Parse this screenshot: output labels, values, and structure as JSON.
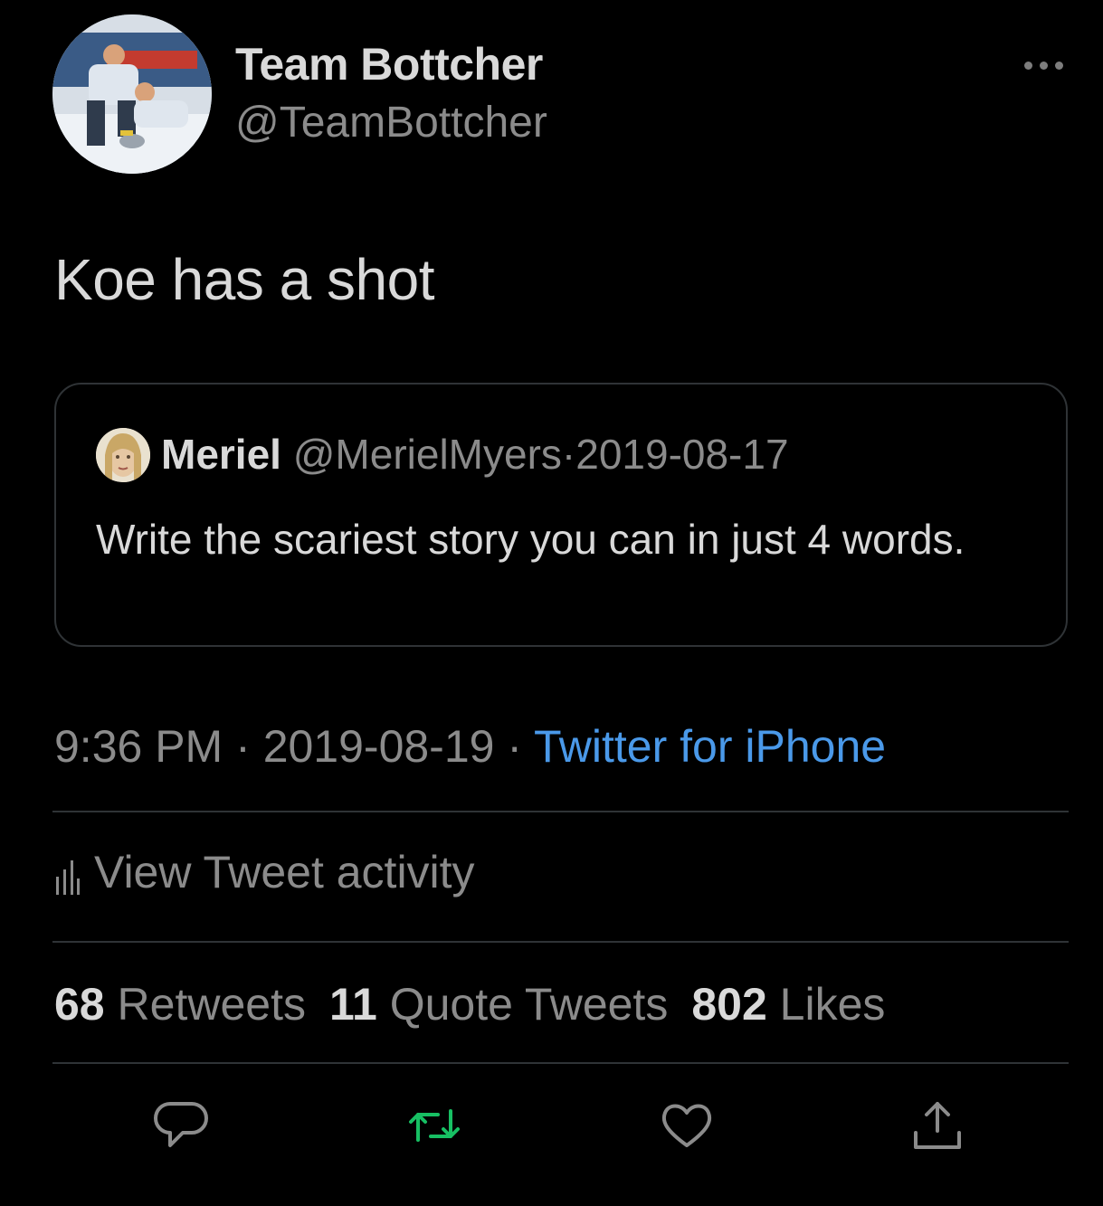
{
  "author": {
    "name": "Team Bottcher",
    "handle": "@TeamBottcher"
  },
  "tweet": {
    "text": "Koe has a shot"
  },
  "quoted": {
    "name": "Meriel",
    "handle": "@MerielMyers",
    "separator": "·",
    "date": "2019-08-17",
    "text": "Write the scariest story you can in just 4 words."
  },
  "meta": {
    "time": "9:36 PM",
    "separator": "·",
    "date": "2019-08-19",
    "source": "Twitter for iPhone"
  },
  "activity": {
    "label": "View Tweet activity"
  },
  "stats": {
    "retweets_count": "68",
    "retweets_label": "Retweets",
    "quotes_count": "11",
    "quotes_label": "Quote Tweets",
    "likes_count": "802",
    "likes_label": "Likes"
  },
  "colors": {
    "background": "#000000",
    "text": "#d9d9d9",
    "muted": "#8b8b8b",
    "link": "#4a99e9",
    "retweet_active": "#17bf63",
    "border": "#2f3336"
  },
  "icons": [
    "more-icon",
    "activity-icon",
    "reply-icon",
    "retweet-icon",
    "like-icon",
    "share-icon"
  ]
}
